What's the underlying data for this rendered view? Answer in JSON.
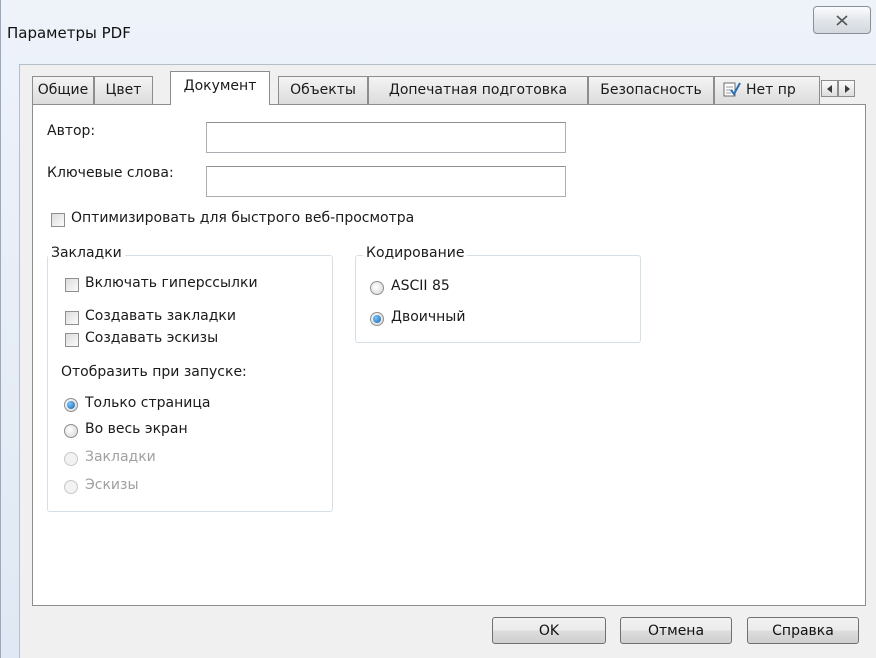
{
  "window": {
    "title": "Параметры PDF"
  },
  "tabs": [
    {
      "label": "Общие"
    },
    {
      "label": "Цвет"
    },
    {
      "label": "Документ"
    },
    {
      "label": "Объекты"
    },
    {
      "label": "Допечатная подготовка"
    },
    {
      "label": "Безопасность"
    },
    {
      "label": "Нет пр"
    }
  ],
  "document": {
    "author_label": "Автор:",
    "author_value": "",
    "keywords_label": "Ключевые слова:",
    "keywords_value": "",
    "optimize_label": "Оптимизировать для быстрого веб-просмотра",
    "optimize_checked": false,
    "bookmarks_group": {
      "title": "Закладки",
      "include_links": "Включать гиперссылки",
      "create_bookmarks": "Создавать закладки",
      "create_thumbnails": "Создавать эскизы",
      "display_label": "Отобразить при запуске:",
      "options": [
        {
          "label": "Только страница",
          "checked": true,
          "disabled": false
        },
        {
          "label": "Во весь экран",
          "checked": false,
          "disabled": false
        },
        {
          "label": "Закладки",
          "checked": false,
          "disabled": true
        },
        {
          "label": "Эскизы",
          "checked": false,
          "disabled": true
        }
      ]
    },
    "encoding_group": {
      "title": "Кодирование",
      "options": [
        {
          "label": "ASCII 85",
          "checked": false
        },
        {
          "label": "Двоичный",
          "checked": true
        }
      ]
    }
  },
  "buttons": {
    "ok": "OK",
    "cancel": "Отмена",
    "help": "Справка"
  },
  "icons": {
    "close": "close-icon",
    "tab_icon": "document-check-icon",
    "scroll_left": "arrow-left-icon",
    "scroll_right": "arrow-right-icon"
  },
  "colors": {
    "accent_radio": "#1565b5",
    "panel": "#ffffff",
    "chrome": "#f0f0f0"
  }
}
